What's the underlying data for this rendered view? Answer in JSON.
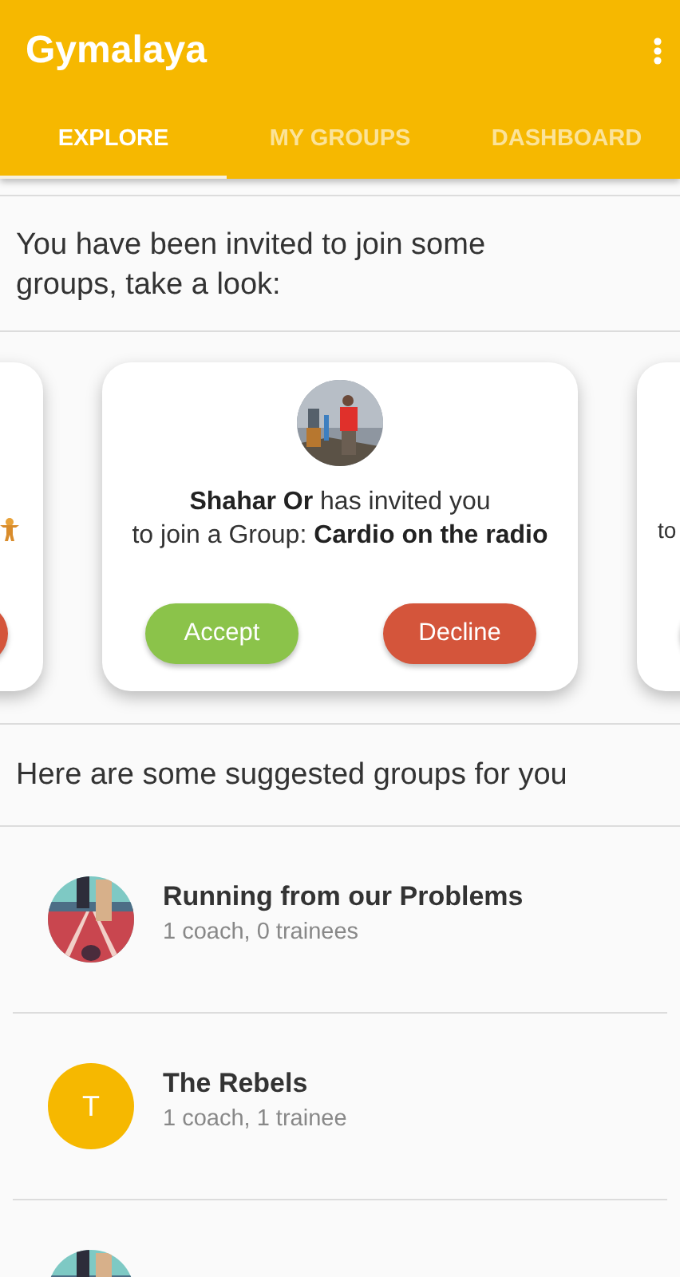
{
  "app_bar": {
    "title": "Gymalaya"
  },
  "tabs": [
    {
      "label": "EXPLORE",
      "selected": true
    },
    {
      "label": "MY GROUPS",
      "selected": false
    },
    {
      "label": "DASHBOARD",
      "selected": false
    }
  ],
  "invitations": {
    "intro": "You have been invited to join some groups, take a look:",
    "cards": [
      {
        "kind": "peek_left"
      },
      {
        "kind": "full",
        "line_1": "**Shahar Or** has invited you",
        "line_2": "to join a Group: **Cardio on the radio**",
        "accept": "Accept",
        "decline": "Decline"
      },
      {
        "kind": "peek_right",
        "text": "to"
      }
    ]
  },
  "suggestions": {
    "heading": "Here are some suggested groups for you",
    "groups": [
      {
        "kind": "picture",
        "name": "Running from our Problems",
        "members": "1 coach, 0 trainees"
      },
      {
        "kind": "letter",
        "letter": "T",
        "name": "The Rebels",
        "members": "1 coach, 1 trainee"
      },
      {
        "kind": "picture"
      }
    ]
  }
}
